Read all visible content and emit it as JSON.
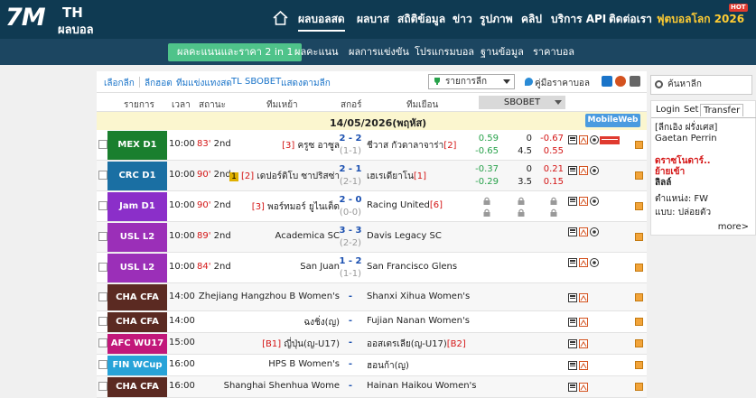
{
  "header": {
    "logo_main": "7M",
    "logo_th": "TH",
    "logo_sub": "ผลบอล",
    "nav": [
      "ผลบอลสด",
      "ผลบาส",
      "สถิติข้อมูล",
      "ข่าว",
      "รูปภาพ",
      "คลิป",
      "บริการ API",
      "ติดต่อเรา",
      "ฟุตบอลโลก 2026"
    ],
    "hot_badge": "HOT"
  },
  "subnav": [
    "ผลคะแนนและราคา 2 in 1",
    "ผลคะแนน",
    "ผลการแข่งขัน",
    "โปรแกรมบอล",
    "ฐานข้อมูล",
    "ราคาบอล"
  ],
  "filters": {
    "links": [
      "เลือกลีก",
      "ลีกฮอต",
      "ทีมแข่งแทงสด",
      "TL",
      "SBOBET",
      "แสดงตามลีก"
    ],
    "league_select": "รายการลีก",
    "guide": "คู่มือราคาบอล"
  },
  "columns": {
    "league": "รายการ",
    "time": "เวลา",
    "status": "สถานะ",
    "home": "ทีมเหย้า",
    "score": "สกอร์",
    "away": "ทีมเยือน",
    "odds_provider": "SBOBET"
  },
  "date": "14/05/2026(พฤหัส)",
  "mobile_button": "MobileWeb",
  "matches": [
    {
      "league": "MEX D1",
      "color": "#1a7f2e",
      "time": "10:00",
      "minute": "83'",
      "status": "2nd",
      "home": "ครูซ อาซูล",
      "home_rank": "[3]",
      "home_card": "",
      "score": "2 - 2",
      "ht": "(1-1)",
      "away": "ชีวาส กัวดาลาจาร่า",
      "away_rank": "[2]",
      "odds": [
        "0.59",
        "0",
        "-0.67",
        "-0.65",
        "4.5",
        "0.55"
      ],
      "locked": false,
      "tv": true
    },
    {
      "league": "CRC D1",
      "color": "#1a6fa3",
      "time": "10:00",
      "minute": "90'",
      "status": "2nd",
      "home": "เดปอร์ติโบ ซาปริสซ่า",
      "home_rank": "[2]",
      "home_card": "1",
      "score": "2 - 1",
      "ht": "(2-1)",
      "away": "เฮเรเดียาโน",
      "away_rank": "[1]",
      "odds": [
        "-0.37",
        "0",
        "0.21",
        "-0.29",
        "3.5",
        "0.15"
      ],
      "locked": false,
      "tv": false
    },
    {
      "league": "Jam D1",
      "color": "#8b2fc9",
      "time": "10:00",
      "minute": "90'",
      "status": "2nd",
      "home": "พอร์ทมอร์ ยูไนเต็ด",
      "home_rank": "[3]",
      "home_card": "",
      "score": "2 - 0",
      "ht": "(0-0)",
      "away": "Racing United",
      "away_rank": "[6]",
      "odds": [],
      "locked": true,
      "tv": false
    },
    {
      "league": "USL L2",
      "color": "#9b2fb8",
      "time": "10:00",
      "minute": "89'",
      "status": "2nd",
      "home": "Academica SC",
      "home_rank": "",
      "home_card": "",
      "score": "3 - 3",
      "ht": "(2-2)",
      "away": "Davis Legacy SC",
      "away_rank": "",
      "odds": [],
      "locked": false,
      "tv": false
    },
    {
      "league": "USL L2",
      "color": "#9b2fb8",
      "time": "10:00",
      "minute": "84'",
      "status": "2nd",
      "home": "San Juan",
      "home_rank": "",
      "home_card": "",
      "score": "1 - 2",
      "ht": "(1-1)",
      "away": "San Francisco Glens",
      "away_rank": "",
      "odds": [],
      "locked": false,
      "tv": false
    },
    {
      "league": "CHA CFA",
      "color": "#5b2a22",
      "time": "14:00",
      "minute": "",
      "status": "",
      "home": "Zhejiang Hangzhou B Women's",
      "home_rank": "",
      "home_card": "",
      "score": "-",
      "ht": "",
      "away": "Shanxi Xihua Women's",
      "away_rank": "",
      "odds": [],
      "locked": false,
      "tv": false
    },
    {
      "league": "CHA CFA",
      "color": "#5b2a22",
      "time": "14:00",
      "minute": "",
      "status": "",
      "home": "ฉงชิ่ง(ญ)",
      "home_rank": "",
      "home_card": "",
      "score": "-",
      "ht": "",
      "away": "Fujian Nanan Women's",
      "away_rank": "",
      "odds": [],
      "locked": false,
      "tv": false
    },
    {
      "league": "AFC WU17",
      "color": "#c2187a",
      "time": "15:00",
      "minute": "",
      "status": "",
      "home": "ญี่ปุ่น(ญ-U17)",
      "home_rank": "[B1]",
      "home_card": "",
      "score": "-",
      "ht": "",
      "away": "ออสเตรเลีย(ญ-U17)",
      "away_rank": "[B2]",
      "odds": [],
      "locked": false,
      "tv": false
    },
    {
      "league": "FIN WCup",
      "color": "#28a3d8",
      "time": "16:00",
      "minute": "",
      "status": "",
      "home": "HPS B Women's",
      "home_rank": "",
      "home_card": "",
      "score": "-",
      "ht": "",
      "away": "ฮอนก้า(ญ)",
      "away_rank": "",
      "odds": [],
      "locked": false,
      "tv": false
    },
    {
      "league": "CHA CFA",
      "color": "#5b2a22",
      "time": "16:00",
      "minute": "",
      "status": "",
      "home": "Shanghai Shenhua Wome",
      "home_rank": "",
      "home_card": "",
      "score": "-",
      "ht": "",
      "away": "Hainan Haikou Women's",
      "away_rank": "",
      "odds": [],
      "locked": false,
      "tv": false
    }
  ],
  "sidebar": {
    "search_placeholder": "ค้นหาลีก",
    "tabs": [
      "Login",
      "Set",
      "Transfer"
    ],
    "transfer_lines": [
      "[ลีกเอิง ฝรั่งเศส] Gaetan Perrin",
      "ดราซโนดาร์..",
      "ย้ายเข้า",
      "ลิลล์",
      "ตำแหน่ง: FW",
      "แบบ: ปล่อยตัว",
      "more>"
    ]
  }
}
